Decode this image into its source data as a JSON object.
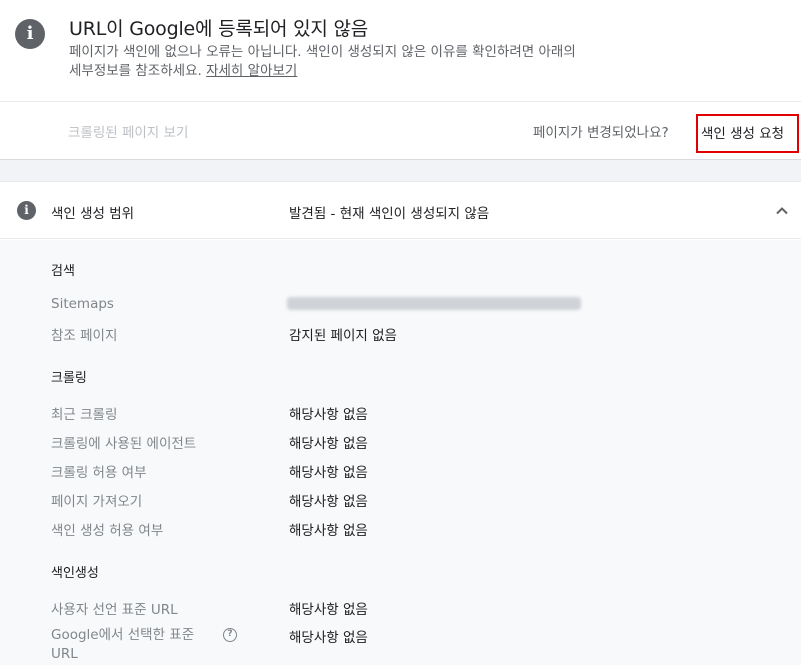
{
  "header": {
    "title": "URL이 Google에 등록되어 있지 않음",
    "description": "페이지가 색인에 없으나 오류는 아닙니다. 색인이 생성되지 않은 이유를 확인하려면 아래의 세부정보를 참조하세요.",
    "learn_more": "자세히 알아보기",
    "icon": "info-icon"
  },
  "actions": {
    "view_crawled": "크롤링된 페이지 보기",
    "changed_question": "페이지가 변경되었나요?",
    "request_indexing": "색인 생성 요청"
  },
  "coverage": {
    "label": "색인 생성 범위",
    "status": "발견됨 - 현재 색인이 생성되지 않음",
    "icon": "info-icon"
  },
  "details": {
    "search": {
      "title": "검색",
      "sitemaps_label": "Sitemaps",
      "referring_label": "참조 페이지",
      "referring_value": "감지된 페이지 없음"
    },
    "crawl": {
      "title": "크롤링",
      "rows": [
        {
          "label": "최근 크롤링",
          "value": "해당사항 없음"
        },
        {
          "label": "크롤링에 사용된 에이전트",
          "value": "해당사항 없음"
        },
        {
          "label": "크롤링 허용 여부",
          "value": "해당사항 없음"
        },
        {
          "label": "페이지 가져오기",
          "value": "해당사항 없음"
        },
        {
          "label": "색인 생성 허용 여부",
          "value": "해당사항 없음"
        }
      ]
    },
    "indexing": {
      "title": "색인생성",
      "rows": [
        {
          "label": "사용자 선언 표준 URL",
          "value": "해당사항 없음"
        },
        {
          "label": "Google에서 선택한 표준 URL",
          "value": "해당사항 없음"
        }
      ]
    }
  }
}
